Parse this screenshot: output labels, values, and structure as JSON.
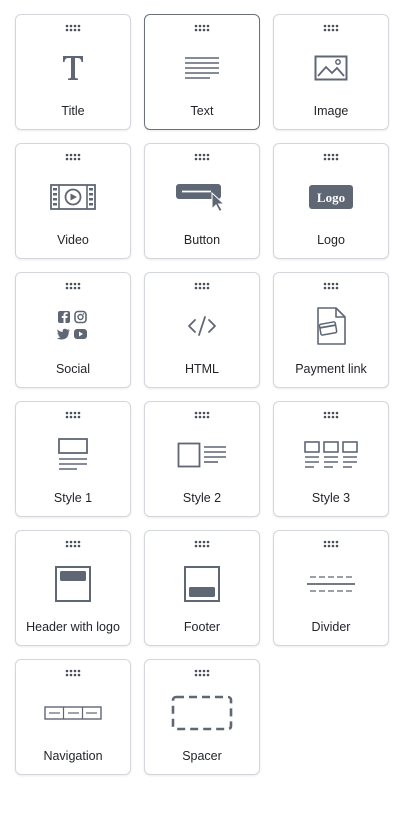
{
  "palette": {
    "icon_color": "#5f6775",
    "border_color": "#d3d6da",
    "selected_border_color": "#6b7079",
    "label_color": "#22252a"
  },
  "blocks": [
    {
      "label": "Title",
      "icon": "title-icon",
      "selected": false
    },
    {
      "label": "Text",
      "icon": "text-icon",
      "selected": true
    },
    {
      "label": "Image",
      "icon": "image-icon",
      "selected": false
    },
    {
      "label": "Video",
      "icon": "video-icon",
      "selected": false
    },
    {
      "label": "Button",
      "icon": "button-icon",
      "selected": false
    },
    {
      "label": "Logo",
      "icon": "logo-icon",
      "selected": false,
      "icon_text": "Logo"
    },
    {
      "label": "Social",
      "icon": "social-icon",
      "selected": false
    },
    {
      "label": "HTML",
      "icon": "html-icon",
      "selected": false
    },
    {
      "label": "Payment link",
      "icon": "payment-link-icon",
      "selected": false
    },
    {
      "label": "Style 1",
      "icon": "style-1-icon",
      "selected": false
    },
    {
      "label": "Style 2",
      "icon": "style-2-icon",
      "selected": false
    },
    {
      "label": "Style 3",
      "icon": "style-3-icon",
      "selected": false
    },
    {
      "label": "Header with logo",
      "icon": "header-with-logo-icon",
      "selected": false
    },
    {
      "label": "Footer",
      "icon": "footer-icon",
      "selected": false
    },
    {
      "label": "Divider",
      "icon": "divider-icon",
      "selected": false
    },
    {
      "label": "Navigation",
      "icon": "navigation-icon",
      "selected": false
    },
    {
      "label": "Spacer",
      "icon": "spacer-icon",
      "selected": false
    }
  ]
}
